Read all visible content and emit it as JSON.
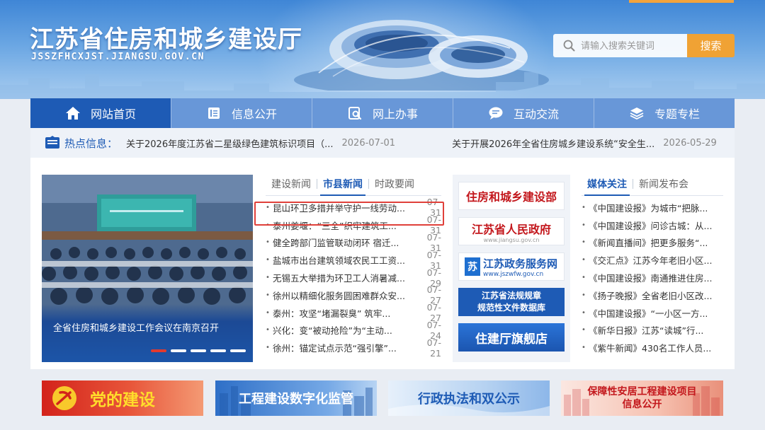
{
  "header": {
    "site_title": "江苏省住房和城乡建设厅",
    "site_domain": "JSSZFHCXJST.JIANGSU.GOV.CN",
    "search_placeholder": "请输入搜索关键词",
    "search_button": "搜索"
  },
  "nav": {
    "items": [
      {
        "label": "网站首页",
        "icon": "home-icon"
      },
      {
        "label": "信息公开",
        "icon": "document-icon"
      },
      {
        "label": "网上办事",
        "icon": "service-search-icon"
      },
      {
        "label": "互动交流",
        "icon": "chat-icon"
      },
      {
        "label": "专题专栏",
        "icon": "layers-icon"
      }
    ]
  },
  "hot": {
    "label": "热点信息：",
    "items": [
      {
        "title": "关于2026年度江苏省二星级绿色建筑标识项目（...",
        "date": "2026-07-01"
      },
      {
        "title": "关于开展2026年全省住房城乡建设系统“安全生...",
        "date": "2026-05-29"
      }
    ]
  },
  "carousel": {
    "caption": "全省住房和城乡建设工作会议在南京召开",
    "slide_count": 5,
    "active_index": 0
  },
  "news": {
    "tabs": [
      "建设新闻",
      "市县新闻",
      "时政要闻"
    ],
    "active_tab": 1,
    "items": [
      {
        "title": "昆山环卫多措并举守护一线劳动...",
        "date": "07-31"
      },
      {
        "title": "泰州姜堰：“三全”织牢建筑工...",
        "date": "07-31"
      },
      {
        "title": "健全跨部门监管联动闭环 宿迁...",
        "date": "07-31"
      },
      {
        "title": "盐城市出台建筑领域农民工工资...",
        "date": "07-31"
      },
      {
        "title": "无锡五大举措为环卫工人消暑减...",
        "date": "07-29"
      },
      {
        "title": "徐州以精细化服务圆困难群众安...",
        "date": "07-27"
      },
      {
        "title": "泰州：攻坚“堵漏裂臭” 筑牢...",
        "date": "07-27"
      },
      {
        "title": "兴化：变“被动抢险”为“主动...",
        "date": "07-24"
      },
      {
        "title": "徐州：锚定试点示范“强引擎”...",
        "date": "07-21"
      }
    ]
  },
  "links": {
    "mohurd": "住房和城乡建设部",
    "gov": "江苏省人民政府",
    "gov_sub": "www.jiangsu.gov.cn",
    "service_logo": "苏",
    "service": "江苏政务服务网",
    "service_sub": "www.jszwfw.gov.cn",
    "regs_line1": "江苏省法规规章",
    "regs_line2": "规范性文件数据库",
    "flagship": "住建厅旗舰店"
  },
  "media": {
    "tabs": [
      "媒体关注",
      "新闻发布会"
    ],
    "active_tab": 0,
    "items": [
      "《中国建设报》为城市“把脉...",
      "《中国建设报》问诊古城：从...",
      "《新闻直播间》把更多服务“...",
      "《交汇点》江苏今年老旧小区...",
      "《中国建设报》南通推进住房...",
      "《扬子晚报》全省老旧小区改...",
      "《中国建设报》“一小区一方...",
      "《新华日报》江苏“读城”行...",
      "《紫牛新闻》430名工作人员..."
    ]
  },
  "banners": {
    "party": "党的建设",
    "digital": "工程建设数字化监管",
    "law": "行政执法和双公示",
    "housing_line1": "保障性安居工程建设项目",
    "housing_line2": "信息公开"
  },
  "colors": {
    "primary": "#1e5bb5",
    "nav": "#6897d8",
    "accent": "#f0a234",
    "highlight": "#e0403a"
  }
}
